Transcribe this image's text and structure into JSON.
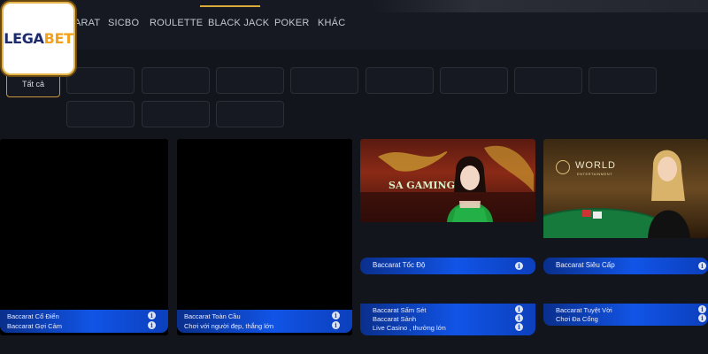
{
  "brand": {
    "logo_text": "LEGABET",
    "logo_primary": "LEGA",
    "logo_accent": "BET",
    "colors": {
      "primary": "#1d2a6b",
      "accent": "#f2a31b",
      "gold_border": "#e6b64c"
    }
  },
  "nav": {
    "items": [
      {
        "label": "ARAT"
      },
      {
        "label": "SICBO"
      },
      {
        "label": "ROULETTE"
      },
      {
        "label": "BLACK JACK"
      },
      {
        "label": "POKER"
      },
      {
        "label": "KHÁC"
      }
    ],
    "active_color": "#d9a93a"
  },
  "filters": {
    "active_label": "Tất cả"
  },
  "cards": [
    {
      "rows": [
        {
          "label": "Baccarat Cổ Điển"
        },
        {
          "label": "Baccarat Gợi Cảm"
        }
      ]
    },
    {
      "rows": [
        {
          "label": "Baccarat Toàn Cầu"
        },
        {
          "label": "Chơi với người đẹp, thắng lớn"
        }
      ]
    },
    {
      "provider_logo": "SA GAMING",
      "title": "Baccarat Tốc Độ",
      "rows": [
        {
          "label": "Baccarat Sấm Sét"
        },
        {
          "label": "Baccarat Sảnh"
        },
        {
          "label": "Live Casino , thưởng lớn"
        }
      ]
    },
    {
      "provider_logo": "WORLD",
      "provider_sub": "ENTERTAINMENT",
      "title": "Baccarat Siêu Cấp",
      "rows": [
        {
          "label": "Baccarat Tuyệt Vời"
        },
        {
          "label": "Chơi Đa Cổng"
        }
      ]
    }
  ],
  "icons": {
    "info": "info-icon",
    "info_glyph": "i"
  }
}
